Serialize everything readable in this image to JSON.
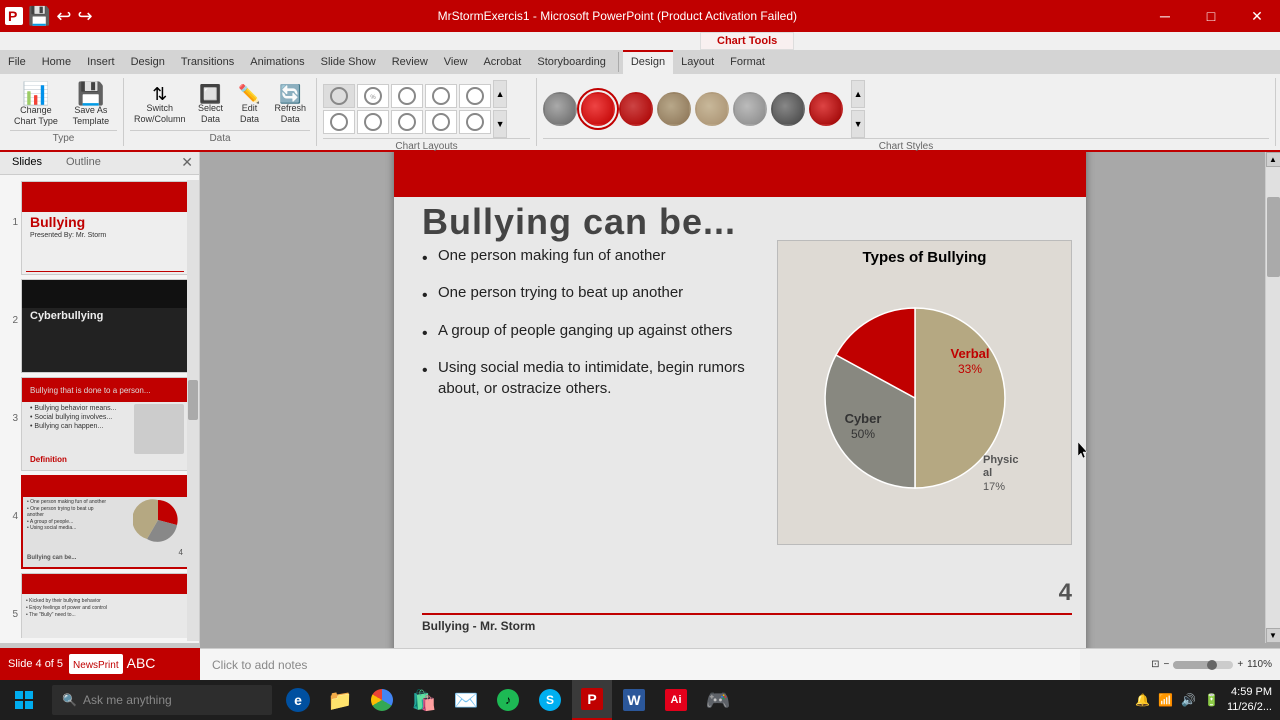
{
  "window": {
    "title": "MrStormExercis1 - Microsoft PowerPoint (Product Activation Failed)",
    "title_left": "MrStormExercis1 - Microsoft PowerPoint (Product Activation Failed)"
  },
  "ribbon": {
    "chart_tools_label": "Chart Tools",
    "tabs": [
      "File",
      "Home",
      "Insert",
      "Design",
      "Transitions",
      "Animations",
      "Slide Show",
      "Review",
      "View",
      "Acrobat",
      "Storyboarding",
      "Design",
      "Layout",
      "Format"
    ],
    "active_tab": "Design",
    "groups": {
      "type": {
        "label": "Type",
        "buttons": [
          "Change Chart Type",
          "Save As Template"
        ]
      },
      "data": {
        "label": "Data",
        "buttons": [
          "Switch Row/Column",
          "Select Data",
          "Edit Data",
          "Refresh Data"
        ]
      },
      "chart_layouts": {
        "label": "Chart Layouts"
      },
      "chart_styles": {
        "label": "Chart Styles"
      }
    }
  },
  "slides_panel": {
    "tabs": [
      "Slides",
      "Outline"
    ],
    "active_tab": "Slides",
    "slides": [
      {
        "number": 1,
        "title": "Bullying",
        "subtitle": "Presented By: Mr. Storm"
      },
      {
        "number": 2,
        "title": "Cyberbullying",
        "subtitle": ""
      },
      {
        "number": 3,
        "title": "Definition",
        "subtitle": ""
      },
      {
        "number": 4,
        "title": "Bullying can be...",
        "subtitle": "",
        "active": true
      },
      {
        "number": 5,
        "title": "",
        "subtitle": ""
      }
    ]
  },
  "slide": {
    "number": 4,
    "title": "Bullying can be...",
    "footer": "Bullying - Mr. Storm",
    "bullets": [
      "One person making fun of another",
      "One person trying to beat up another",
      "A group of people ganging up against others",
      "Using social media to intimidate, begin rumors about, or ostracize others."
    ],
    "chart": {
      "title": "Types of Bullying",
      "slices": [
        {
          "label": "Cyber",
          "percent": 50,
          "color": "#b5a882",
          "x": "50%",
          "y": "56%"
        },
        {
          "label": "Verbal",
          "percent": 33,
          "color": "#c00000",
          "x": "72%",
          "y": "35%"
        },
        {
          "label": "Physical",
          "percent": 17,
          "color": "#888880",
          "x": "83%",
          "y": "72%"
        }
      ]
    }
  },
  "notes": {
    "placeholder": "Click to add notes"
  },
  "status_bar": {
    "slide_info": "Slide 4 of 5",
    "theme": "NewsPrint",
    "zoom": "110%"
  },
  "taskbar": {
    "search_placeholder": "Ask me anything",
    "time": "4:59 PM",
    "date": "11/26/2..."
  },
  "icons": {
    "minimize": "─",
    "maximize": "□",
    "close": "✕",
    "bullet": "•",
    "windows_logo": "⊞",
    "back": "◀",
    "forward": "▶",
    "up": "▲",
    "down": "▼"
  }
}
